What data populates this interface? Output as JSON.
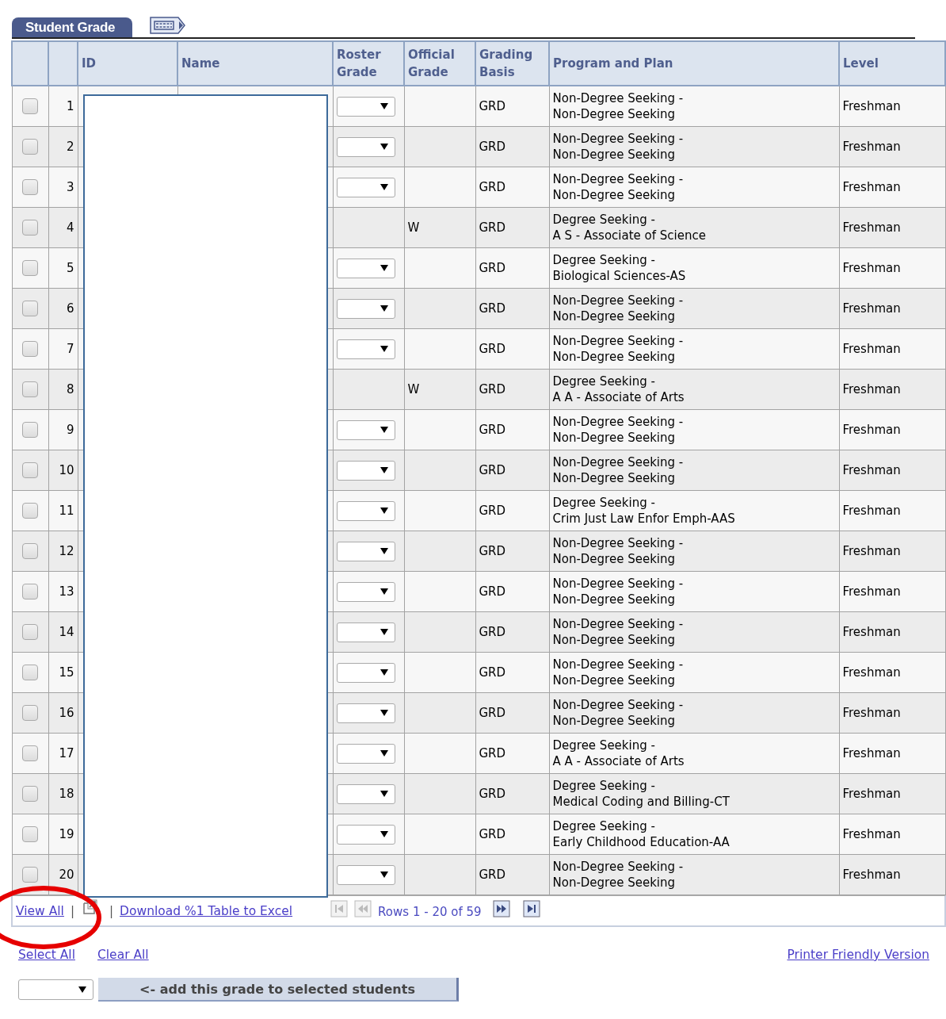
{
  "tab": {
    "label": "Student Grade",
    "selected": true
  },
  "columns": [
    "ID",
    "Name",
    "Roster Grade",
    "Official Grade",
    "Grading Basis",
    "Program and Plan",
    "Level"
  ],
  "rows": [
    {
      "selected": false,
      "number": "1",
      "grade_field": true,
      "grading_basis": "GRD",
      "program": "Non-Degree Seeking -",
      "plan": "Non-Degree Seeking",
      "level": "Freshman"
    },
    {
      "selected": false,
      "number": "2",
      "grade_field": true,
      "grading_basis": "GRD",
      "program": "Non-Degree Seeking -",
      "plan": "Non-Degree Seeking",
      "level": "Freshman"
    },
    {
      "selected": false,
      "number": "3",
      "grade_field": true,
      "grading_basis": "GRD",
      "program": "Non-Degree Seeking -",
      "plan": "Non-Degree Seeking",
      "level": "Freshman"
    },
    {
      "selected": false,
      "number": "4",
      "grade_field": false,
      "official_grade": "W",
      "grading_basis": "GRD",
      "program": "Degree Seeking -",
      "plan": "A S - Associate of Science",
      "level": "Freshman"
    },
    {
      "selected": false,
      "number": "5",
      "grade_field": true,
      "grading_basis": "GRD",
      "program": "Degree Seeking -",
      "plan": "Biological Sciences-AS",
      "level": "Freshman"
    },
    {
      "selected": false,
      "number": "6",
      "grade_field": true,
      "grading_basis": "GRD",
      "program": "Non-Degree Seeking -",
      "plan": "Non-Degree Seeking",
      "level": "Freshman"
    },
    {
      "selected": false,
      "number": "7",
      "grade_field": true,
      "grading_basis": "GRD",
      "program": "Non-Degree Seeking -",
      "plan": "Non-Degree Seeking",
      "level": "Freshman"
    },
    {
      "selected": false,
      "number": "8",
      "grade_field": false,
      "official_grade": "W",
      "grading_basis": "GRD",
      "program": "Degree Seeking -",
      "plan": "A A - Associate of Arts",
      "level": "Freshman"
    },
    {
      "selected": false,
      "number": "9",
      "grade_field": true,
      "grading_basis": "GRD",
      "program": "Non-Degree Seeking -",
      "plan": "Non-Degree Seeking",
      "level": "Freshman"
    },
    {
      "selected": false,
      "number": "10",
      "grade_field": true,
      "grading_basis": "GRD",
      "program": "Non-Degree Seeking -",
      "plan": "Non-Degree Seeking",
      "level": "Freshman"
    },
    {
      "selected": false,
      "number": "11",
      "grade_field": true,
      "grading_basis": "GRD",
      "program": "Degree Seeking -",
      "plan": "Crim Just Law Enfor Emph-AAS",
      "level": "Freshman"
    },
    {
      "selected": false,
      "number": "12",
      "grade_field": true,
      "grading_basis": "GRD",
      "program": "Non-Degree Seeking -",
      "plan": "Non-Degree Seeking",
      "level": "Freshman"
    },
    {
      "selected": false,
      "number": "13",
      "grade_field": true,
      "grading_basis": "GRD",
      "program": "Non-Degree Seeking -",
      "plan": "Non-Degree Seeking",
      "level": "Freshman"
    },
    {
      "selected": false,
      "number": "14",
      "grade_field": true,
      "grading_basis": "GRD",
      "program": "Non-Degree Seeking -",
      "plan": "Non-Degree Seeking",
      "level": "Freshman"
    },
    {
      "selected": false,
      "number": "15",
      "grade_field": true,
      "grading_basis": "GRD",
      "program": "Non-Degree Seeking -",
      "plan": "Non-Degree Seeking",
      "level": "Freshman"
    },
    {
      "selected": false,
      "number": "16",
      "grade_field": true,
      "grading_basis": "GRD",
      "program": "Non-Degree Seeking -",
      "plan": "Non-Degree Seeking",
      "level": "Freshman"
    },
    {
      "selected": false,
      "number": "17",
      "grade_field": true,
      "grading_basis": "GRD",
      "program": "Degree Seeking -",
      "plan": "A A - Associate of Arts",
      "level": "Freshman"
    },
    {
      "selected": false,
      "number": "18",
      "grade_field": true,
      "grading_basis": "GRD",
      "program": "Degree Seeking -",
      "plan": "Medical Coding and Billing-CT",
      "level": "Freshman"
    },
    {
      "selected": false,
      "number": "19",
      "grade_field": true,
      "grading_basis": "GRD",
      "program": "Degree Seeking -",
      "plan": "Early Childhood Education-AA",
      "level": "Freshman"
    },
    {
      "selected": false,
      "number": "20",
      "grade_field": true,
      "grading_basis": "GRD",
      "program": "Non-Degree Seeking -",
      "plan": "Non-Degree Seeking",
      "level": "Freshman"
    }
  ],
  "footer": {
    "view_all": "View All",
    "separator_1": "|",
    "separator_2": "|",
    "download": "Download %1 Table to Excel",
    "rows_info": "Rows 1 - 20 of 59"
  },
  "links": {
    "select_all": "Select All",
    "clear_all": "Clear All",
    "printer": "Printer Friendly Version"
  },
  "add_button": "<- add this grade to selected students"
}
